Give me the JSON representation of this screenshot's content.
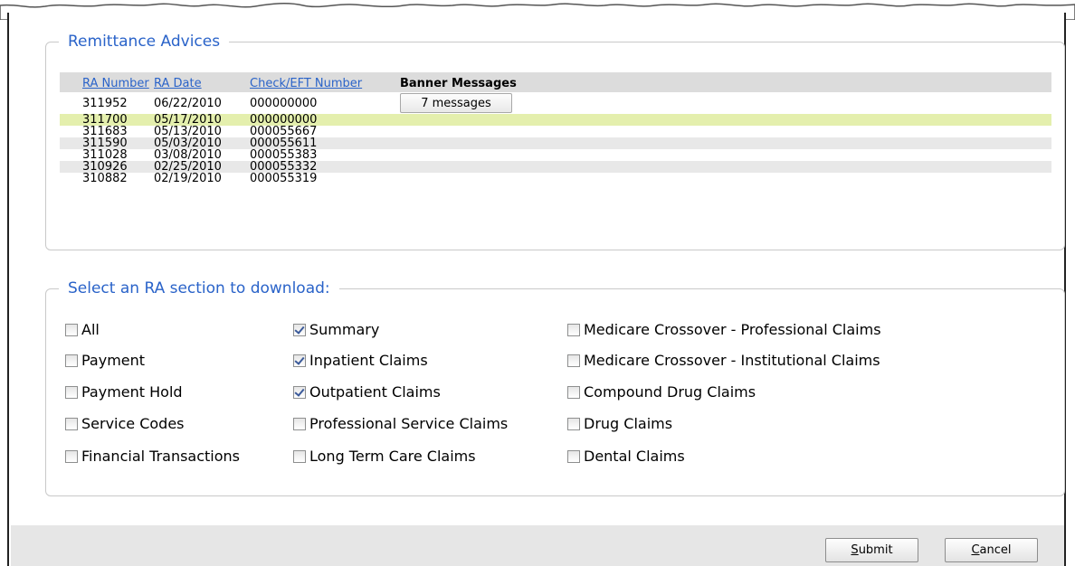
{
  "remittance": {
    "legend": "Remittance Advices",
    "headers": {
      "ra_number": "RA Number",
      "ra_date": "RA Date",
      "check_eft": "Check/EFT Number",
      "banner": "Banner Messages"
    },
    "rows": [
      {
        "ra_number": "311952",
        "ra_date": "06/22/2010",
        "check_eft": "000000000",
        "banner": "7 messages"
      },
      {
        "ra_number": "311700",
        "ra_date": "05/17/2010",
        "check_eft": "000000000",
        "banner": ""
      },
      {
        "ra_number": "311683",
        "ra_date": "05/13/2010",
        "check_eft": "000055667",
        "banner": ""
      },
      {
        "ra_number": "311590",
        "ra_date": "05/03/2010",
        "check_eft": "000055611",
        "banner": ""
      },
      {
        "ra_number": "311028",
        "ra_date": "03/08/2010",
        "check_eft": "000055383",
        "banner": ""
      },
      {
        "ra_number": "310926",
        "ra_date": "02/25/2010",
        "check_eft": "000055332",
        "banner": ""
      },
      {
        "ra_number": "310882",
        "ra_date": "02/19/2010",
        "check_eft": "000055319",
        "banner": ""
      }
    ],
    "selected_row": 1
  },
  "sections": {
    "legend": "Select an RA section to download:",
    "columns": [
      [
        {
          "label": "All",
          "checked": false
        },
        {
          "label": "Payment",
          "checked": false
        },
        {
          "label": "Payment Hold",
          "checked": false
        },
        {
          "label": "Service Codes",
          "checked": false
        },
        {
          "label": "Financial Transactions",
          "checked": false
        }
      ],
      [
        {
          "label": "Summary",
          "checked": true
        },
        {
          "label": "Inpatient Claims",
          "checked": true
        },
        {
          "label": "Outpatient Claims",
          "checked": true
        },
        {
          "label": "Professional Service Claims",
          "checked": false
        },
        {
          "label": "Long Term Care Claims",
          "checked": false
        }
      ],
      [
        {
          "label": "Medicare Crossover - Professional Claims",
          "checked": false
        },
        {
          "label": "Medicare Crossover - Institutional Claims",
          "checked": false
        },
        {
          "label": "Compound Drug Claims",
          "checked": false
        },
        {
          "label": "Drug Claims",
          "checked": false
        },
        {
          "label": "Dental Claims",
          "checked": false
        }
      ]
    ]
  },
  "actions": {
    "submit_accel": "S",
    "submit_rest": "ubmit",
    "cancel_accel": "C",
    "cancel_rest": "ancel"
  },
  "colors": {
    "accent": "#2a63c9",
    "selected_row": "#e4efad",
    "header_bg": "#dcdcdc",
    "bottom_bar": "#e6e6e6"
  }
}
